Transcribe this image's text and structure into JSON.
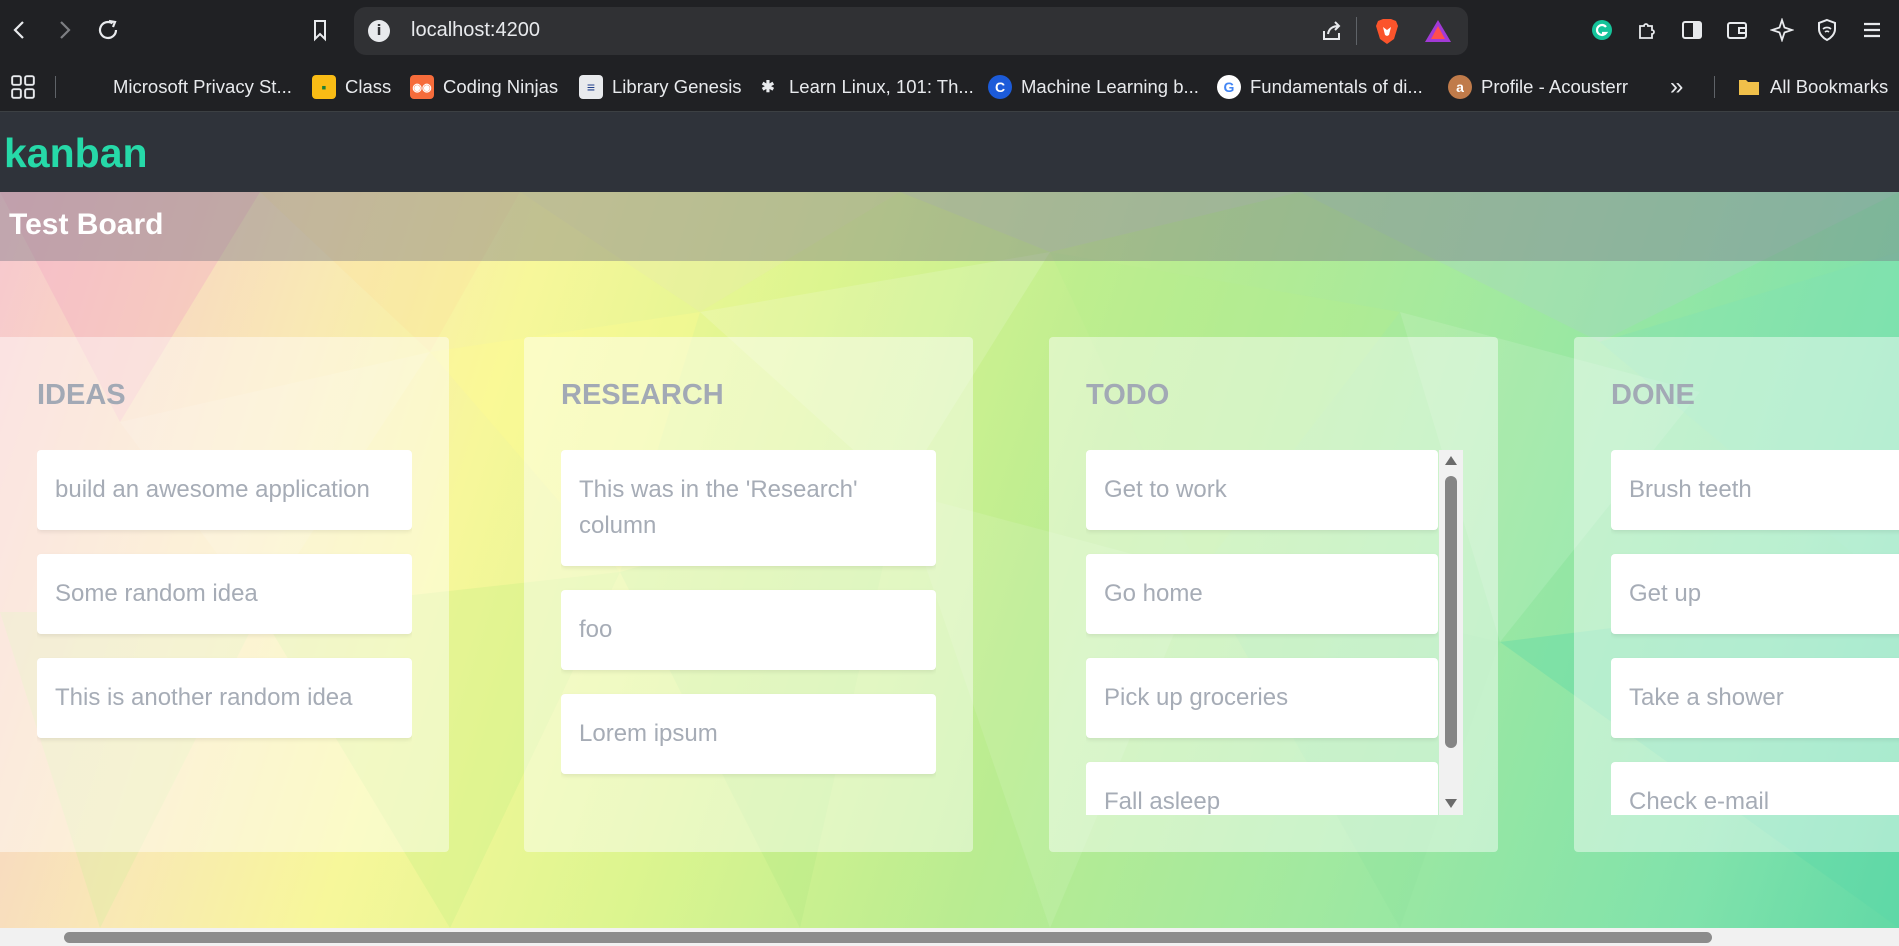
{
  "browser": {
    "url": "localhost:4200",
    "bookmarks": [
      {
        "label": "Microsoft Privacy St...",
        "icon": "microsoft-icon"
      },
      {
        "label": "Class",
        "icon": "google-classroom-icon"
      },
      {
        "label": "Coding Ninjas",
        "icon": "coding-ninjas-icon"
      },
      {
        "label": "Library Genesis",
        "icon": "library-genesis-icon"
      },
      {
        "label": "Learn Linux, 101: Th...",
        "icon": "bee-icon"
      },
      {
        "label": "Machine Learning b...",
        "icon": "coursera-icon"
      },
      {
        "label": "Fundamentals of di...",
        "icon": "google-icon"
      },
      {
        "label": "Profile - Acousterr",
        "icon": "acousterr-icon"
      }
    ],
    "all_bookmarks": "All Bookmarks",
    "overflow": "»"
  },
  "app": {
    "logo": "kanban",
    "accent_color": "#26d9a8",
    "board_title": "Test Board",
    "columns": [
      {
        "title": "IDEAS",
        "cards": [
          "build an awesome application",
          "Some random idea",
          "This is another random idea"
        ]
      },
      {
        "title": "RESEARCH",
        "cards": [
          "This was in the 'Research' column",
          "foo",
          "Lorem ipsum"
        ]
      },
      {
        "title": "TODO",
        "cards": [
          "Get to work",
          "Go home",
          "Pick up groceries",
          "Fall asleep"
        ]
      },
      {
        "title": "DONE",
        "cards": [
          "Brush teeth",
          "Get up",
          "Take a shower",
          "Check e-mail"
        ]
      }
    ]
  }
}
